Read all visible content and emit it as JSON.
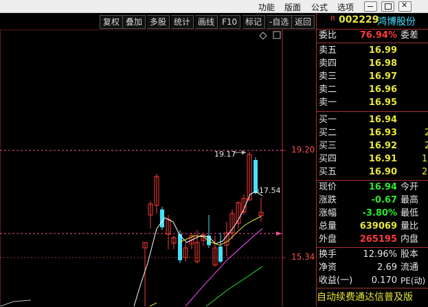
{
  "menubar": {
    "items": [
      "功能",
      "版面",
      "公式",
      "选项"
    ]
  },
  "toolbar": {
    "buttons": [
      "复权",
      "叠加",
      "多股",
      "统计",
      "画线",
      "F10",
      "标记",
      "-自选",
      "返回"
    ]
  },
  "chart": {
    "y_labels": [
      "19.20",
      "15.34"
    ],
    "peak_label": "19.17",
    "last_label": "17.54",
    "colors": {
      "up": "#ff3b3b",
      "down": "#47e0ff",
      "ma5": "#ffffff",
      "ma10": "#e8e83a",
      "ma20": "#e040e0",
      "ma60": "#2ee62e",
      "dash": "#ff4fa0"
    }
  },
  "quote": {
    "badge": "R",
    "code": "002229",
    "name": "鸿博股份",
    "weibi_label": "委比",
    "weibi_value": "76.94%",
    "weicha_label": "委差",
    "sells": [
      {
        "label": "卖五",
        "price": "16.99"
      },
      {
        "label": "卖四",
        "price": "16.98"
      },
      {
        "label": "卖三",
        "price": "16.97"
      },
      {
        "label": "卖二",
        "price": "16.96"
      },
      {
        "label": "卖一",
        "price": "16.95"
      }
    ],
    "buys": [
      {
        "label": "买一",
        "price": "16.94",
        "extra": ""
      },
      {
        "label": "买二",
        "price": "16.93",
        "extra": "2"
      },
      {
        "label": "买三",
        "price": "16.92",
        "extra": "2"
      },
      {
        "label": "买四",
        "price": "16.91",
        "extra": "1"
      },
      {
        "label": "买五",
        "price": "16.90",
        "extra": "2"
      }
    ],
    "stats": [
      {
        "label": "现价",
        "value": "16.94",
        "label2": "今开",
        "color": "g"
      },
      {
        "label": "涨跌",
        "value": "-0.67",
        "label2": "最高",
        "color": "g"
      },
      {
        "label": "涨幅",
        "value": "-3.80%",
        "label2": "最低",
        "color": "g"
      },
      {
        "label": "总量",
        "value": "639069",
        "label2": "量比",
        "color": "y"
      },
      {
        "label": "外盘",
        "value": "265195",
        "label2": "内盘",
        "color": "r"
      }
    ],
    "stats2": [
      {
        "label": "换手",
        "value": "12.96%",
        "label2": "股本"
      },
      {
        "label": "净资",
        "value": "2.69",
        "label2": "流通"
      },
      {
        "label": "收益(一)",
        "value": "0.170",
        "label2": "PE(动)"
      }
    ],
    "ticker": "自动续费通达信普及版"
  }
}
